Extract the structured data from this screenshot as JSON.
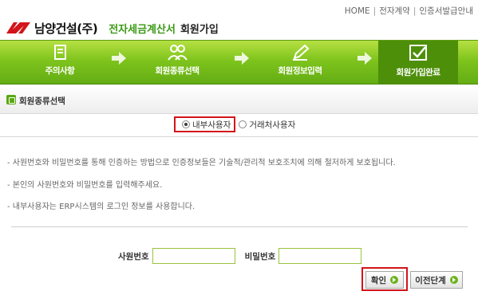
{
  "top_nav": {
    "items": [
      "HOME",
      "전자계약",
      "인증서발급안내"
    ]
  },
  "header": {
    "company": "남양건설(주)",
    "service": "전자세금계산서",
    "page_title": "회원가입"
  },
  "steps": [
    {
      "label": "주의사항",
      "icon": "notice-icon",
      "active": false
    },
    {
      "label": "회원종류선택",
      "icon": "users-icon",
      "active": false
    },
    {
      "label": "회원정보입력",
      "icon": "pencil-icon",
      "active": false
    },
    {
      "label": "회원가입완료",
      "icon": "checkbox-icon",
      "active": true
    }
  ],
  "section": {
    "title": "회원종류선택"
  },
  "member_type": {
    "options": [
      "내부사용자",
      "거래처사용자"
    ],
    "selected": "내부사용자"
  },
  "info_lines": [
    "- 사원번호와 비밀번호를 통해 인증하는 방법으로 인증정보들은 기술적/관리적 보호조치에 의해 철저하게 보호됩니다.",
    "- 본인의 사원번호와 비밀번호를 입력해주세요.",
    "- 내부사용자는 ERP시스템의 로그인 정보를 사용합니다."
  ],
  "form": {
    "employee_id_label": "사원번호",
    "employee_id_value": "",
    "password_label": "비밀번호",
    "password_value": ""
  },
  "buttons": {
    "confirm": "확인",
    "previous": "이전단계"
  },
  "colors": {
    "brand_green": "#7fc41d",
    "active_step": "#4e8f0a",
    "highlight_red": "#d2141b",
    "logo_red": "#d2141b"
  }
}
